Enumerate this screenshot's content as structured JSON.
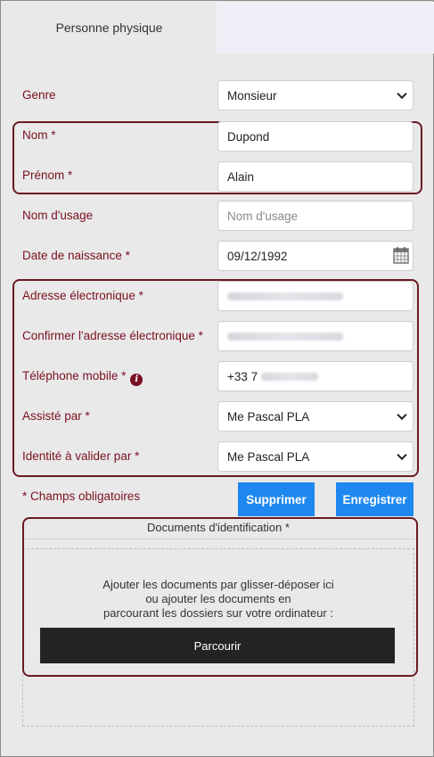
{
  "tabs": {
    "active": "Personne physique",
    "inactive": ""
  },
  "form": {
    "genre": {
      "label": "Genre",
      "value": "Monsieur"
    },
    "nom": {
      "label": "Nom *",
      "value": "Dupond"
    },
    "prenom": {
      "label": "Prénom *",
      "value": "Alain"
    },
    "nom_usage": {
      "label": "Nom d'usage",
      "placeholder": "Nom d'usage"
    },
    "date_naissance": {
      "label": "Date de naissance *",
      "value": "09/12/1992"
    },
    "email": {
      "label": "Adresse électronique *"
    },
    "email_confirm": {
      "label": "Confirmer l'adresse électronique *"
    },
    "telephone": {
      "label": "Téléphone mobile *",
      "prefix": "+33 7"
    },
    "assiste_par": {
      "label": "Assisté par *",
      "value": "Me Pascal PLA"
    },
    "identite_valider": {
      "label": "Identité à valider par *",
      "value": "Me Pascal PLA"
    },
    "required_note": "* Champs obligatoires"
  },
  "buttons": {
    "delete": "Supprimer",
    "save": "Enregistrer"
  },
  "documents": {
    "title": "Documents d'identification *",
    "dropzone_line1": "Ajouter les documents par glisser-déposer ici",
    "dropzone_line2": "ou ajouter les documents en",
    "dropzone_line3": "parcourant les dossiers sur votre ordinateur :",
    "browse": "Parcourir"
  },
  "colors": {
    "label": "#7a1022",
    "button": "#1e88f0",
    "highlight": "#6b1a24",
    "browse": "#222322"
  }
}
